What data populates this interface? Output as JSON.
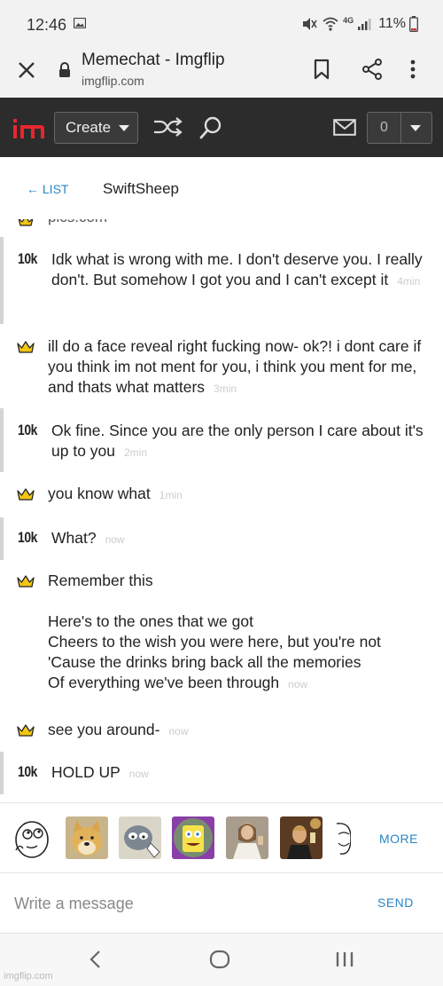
{
  "status_bar": {
    "time": "12:46",
    "battery": "11%",
    "network": "4G"
  },
  "browser": {
    "title": "Memechat - Imgflip",
    "url": "imgflip.com"
  },
  "nav": {
    "create_label": "Create",
    "notification_count": "0"
  },
  "chat": {
    "back_label": "← LIST",
    "username": "SwiftSheep",
    "cut_off_text": "pics.com",
    "messages": [
      {
        "sender": "other",
        "badge": "10k",
        "text": "Idk what is wrong with me. I don't deserve you. I really don't. But somehow I got you and I can't except it",
        "time": "4min"
      },
      {
        "sender": "me",
        "badge": "crown",
        "text": "ill do a face reveal right fucking now- ok?! i dont care if you think im not ment for you, i think you ment for me, and thats what matters",
        "time": "3min"
      },
      {
        "sender": "other",
        "badge": "10k",
        "text": "Ok fine. Since you are the only person I care about it's up to you",
        "time": "2min"
      },
      {
        "sender": "me",
        "badge": "crown",
        "text": "you know what",
        "time": "1min"
      },
      {
        "sender": "other",
        "badge": "10k",
        "text": "What?",
        "time": "now"
      },
      {
        "sender": "me",
        "badge": "crown",
        "text": "Remember this\n\nHere's to the ones that we got\nCheers to the wish you were here, but you're not\n'Cause the drinks bring back all the memories\nOf everything we've been through",
        "time": "now"
      },
      {
        "sender": "me",
        "badge": "crown",
        "text": "see you around-",
        "time": "now"
      },
      {
        "sender": "other",
        "badge": "10k",
        "text": "HOLD UP",
        "time": "now"
      }
    ]
  },
  "emoji_strip": {
    "items": [
      "rage-face-thinking",
      "doge",
      "skeptical-cat",
      "imagination-spongebob",
      "buddy-christ",
      "leonardo-toast",
      "troll-face"
    ],
    "more_label": "MORE"
  },
  "compose": {
    "placeholder": "Write a message",
    "send_label": "SEND"
  },
  "watermark": "imgflip.com",
  "colors": {
    "accent": "#2a86c6",
    "nav_bg": "#2c2c2c",
    "logo_red": "#e8262d",
    "crown": "#f3c614"
  }
}
